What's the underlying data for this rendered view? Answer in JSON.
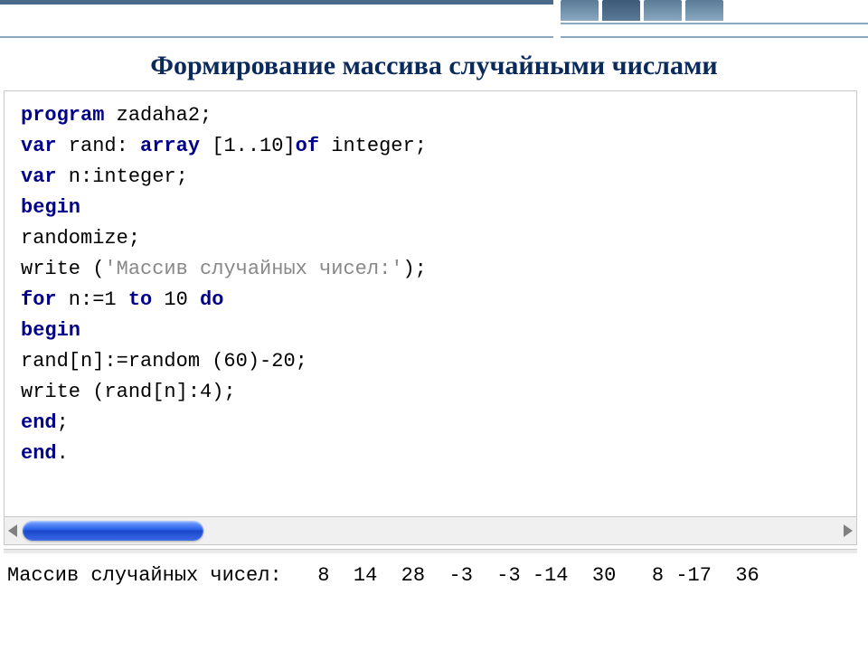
{
  "title": "Формирование массива случайными числами",
  "code": {
    "l1": {
      "kw1": "program",
      "rest": " zadaha2;"
    },
    "l2": {
      "kw1": "var",
      "mid1": " rand: ",
      "kw2": "array",
      "mid2": " [1..10]",
      "kw3": "of",
      "rest": " integer;"
    },
    "l3": {
      "kw1": "var",
      "rest": " n:integer;"
    },
    "l4": {
      "kw1": "begin"
    },
    "l5": {
      "rest": "randomize;"
    },
    "l6": {
      "pre": "write (",
      "str": "'Массив случайных чисел:'",
      "post": ");"
    },
    "l7": {
      "kw1": "for",
      "mid1": " n:=1 ",
      "kw2": "to",
      "mid2": " 10 ",
      "kw3": "do"
    },
    "l8": {
      "kw1": "begin"
    },
    "l9": {
      "rest": "rand[n]:=random (60)-20;"
    },
    "l10": {
      "rest": "write (rand[n]:4);"
    },
    "l11": {
      "kw1": "end",
      "post": ";"
    },
    "l12": {
      "kw1": "end",
      "post": "."
    }
  },
  "output": {
    "label": "Массив случайных чисел:",
    "values": "   8  14  28  -3  -3 -14  30   8 -17  36"
  }
}
